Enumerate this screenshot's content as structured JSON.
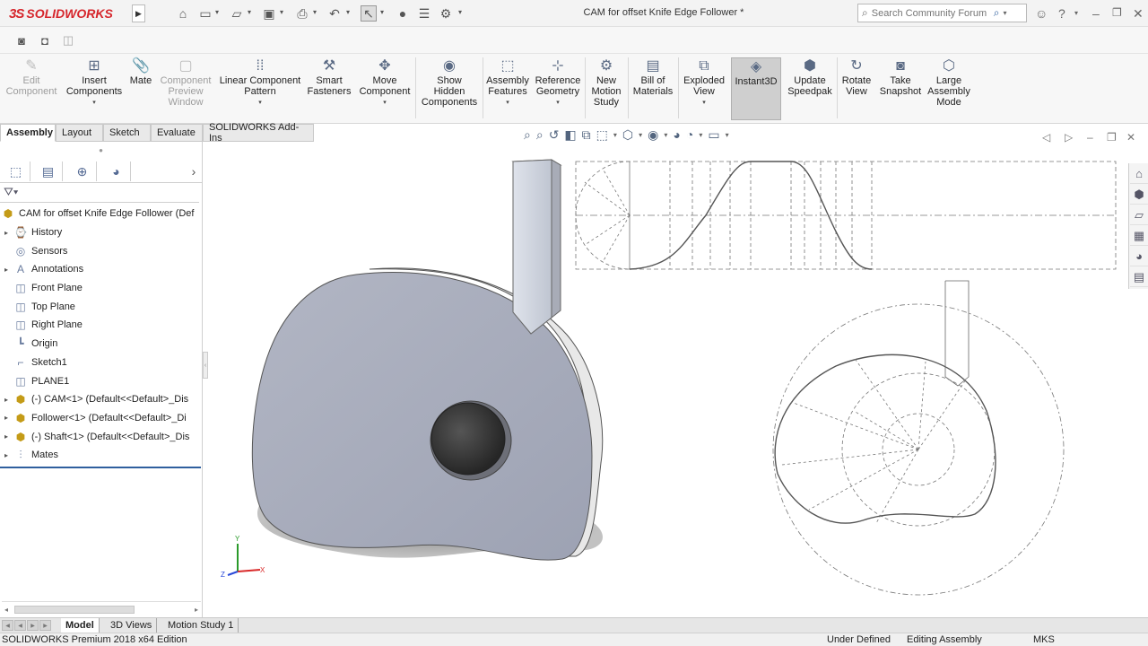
{
  "titlebar": {
    "brand": "SOLIDWORKS",
    "document_title": "CAM for offset Knife Edge Follower *",
    "search_placeholder": "Search Community Forum",
    "quick_access_icons": [
      "home-icon",
      "new-document-icon",
      "open-icon",
      "save-icon",
      "print-icon",
      "undo-icon",
      "select-icon",
      "rebuild-icon",
      "file-properties-icon",
      "options-icon"
    ],
    "right_icons": [
      "user-icon",
      "help-icon",
      "minimize-icon",
      "restore-icon",
      "close-icon"
    ]
  },
  "ribbon": {
    "buttons": [
      {
        "id": "edit-component",
        "label": "Edit\nComponent",
        "disabled": true
      },
      {
        "id": "insert-components",
        "label": "Insert\nComponents",
        "dropdown": true
      },
      {
        "id": "mate",
        "label": "Mate"
      },
      {
        "id": "component-preview-window",
        "label": "Component\nPreview\nWindow",
        "disabled": true
      },
      {
        "id": "linear-component-pattern",
        "label": "Linear Component\nPattern",
        "dropdown": true
      },
      {
        "id": "smart-fasteners",
        "label": "Smart\nFasteners"
      },
      {
        "id": "move-component",
        "label": "Move\nComponent",
        "dropdown": true
      },
      {
        "id": "show-hidden-components",
        "label": "Show\nHidden\nComponents"
      },
      {
        "id": "assembly-features",
        "label": "Assembly\nFeatures",
        "dropdown": true
      },
      {
        "id": "reference-geometry",
        "label": "Reference\nGeometry",
        "dropdown": true
      },
      {
        "id": "new-motion-study",
        "label": "New\nMotion\nStudy"
      },
      {
        "id": "bill-of-materials",
        "label": "Bill of\nMaterials"
      },
      {
        "id": "exploded-view",
        "label": "Exploded\nView",
        "dropdown": true
      },
      {
        "id": "instant3d",
        "label": "Instant3D",
        "active": true
      },
      {
        "id": "update-speedpak",
        "label": "Update\nSpeedpak"
      },
      {
        "id": "rotate-view",
        "label": "Rotate\nView"
      },
      {
        "id": "take-snapshot",
        "label": "Take\nSnapshot"
      },
      {
        "id": "large-assembly-mode",
        "label": "Large\nAssembly\nMode"
      }
    ]
  },
  "tabs": [
    "Assembly",
    "Layout",
    "Sketch",
    "Evaluate",
    "SOLIDWORKS Add-Ins"
  ],
  "tree": {
    "root": "CAM for offset Knife Edge Follower  (Def",
    "items": [
      {
        "label": "History",
        "expand": true,
        "icon": "history-icon"
      },
      {
        "label": "Sensors",
        "expand": false,
        "icon": "sensor-icon"
      },
      {
        "label": "Annotations",
        "expand": true,
        "icon": "annotations-icon"
      },
      {
        "label": "Front Plane",
        "expand": false,
        "icon": "plane-icon"
      },
      {
        "label": "Top Plane",
        "expand": false,
        "icon": "plane-icon"
      },
      {
        "label": "Right Plane",
        "expand": false,
        "icon": "plane-icon"
      },
      {
        "label": "Origin",
        "expand": false,
        "icon": "origin-icon"
      },
      {
        "label": "Sketch1",
        "expand": false,
        "icon": "sketch-icon"
      },
      {
        "label": "PLANE1",
        "expand": false,
        "icon": "plane-icon"
      },
      {
        "label": "(-) CAM<1> (Default<<Default>_Dis",
        "expand": true,
        "icon": "part-icon"
      },
      {
        "label": "Follower<1> (Default<<Default>_Di",
        "expand": true,
        "icon": "part-icon"
      },
      {
        "label": "(-) Shaft<1> (Default<<Default>_Dis",
        "expand": true,
        "icon": "part-icon"
      },
      {
        "label": "Mates",
        "expand": true,
        "icon": "mates-icon"
      }
    ]
  },
  "bottom_tabs": [
    "Model",
    "3D Views",
    "Motion Study 1"
  ],
  "status": {
    "edition": "SOLIDWORKS Premium 2018 x64 Edition",
    "definition": "Under Defined",
    "mode": "Editing Assembly",
    "units": "MKS"
  },
  "colors": {
    "brand_red": "#d6262c",
    "cam_face": "#a5a9b8",
    "active_button": "#cfcfcf"
  }
}
